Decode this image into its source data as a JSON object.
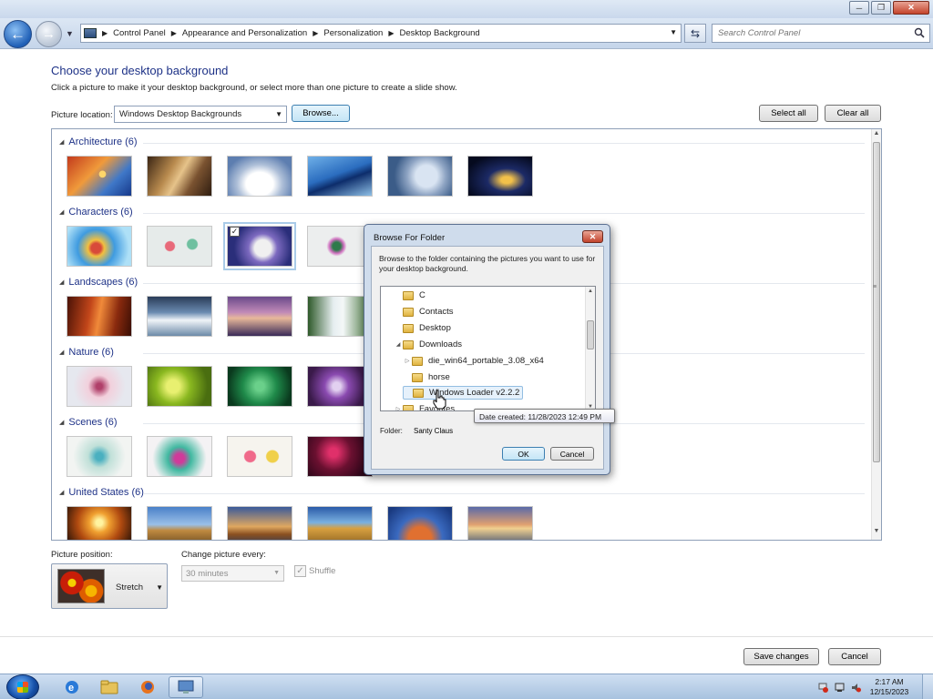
{
  "window": {
    "caption_buttons": {
      "minimize": "minimize-icon",
      "maximize": "restore-icon",
      "close": "close-icon"
    }
  },
  "navbar": {
    "breadcrumbs": [
      "Control Panel",
      "Appearance and Personalization",
      "Personalization",
      "Desktop Background"
    ],
    "search_placeholder": "Search Control Panel"
  },
  "main": {
    "title": "Choose your desktop background",
    "subtitle": "Click a picture to make it your desktop background, or select more than one picture to create a slide show.",
    "picture_location_label": "Picture location:",
    "picture_location_value": "Windows Desktop Backgrounds",
    "browse_label": "Browse...",
    "select_all_label": "Select all",
    "clear_all_label": "Clear all",
    "groups": [
      {
        "label": "Architecture (6)"
      },
      {
        "label": "Characters (6)"
      },
      {
        "label": "Landscapes (6)"
      },
      {
        "label": "Nature (6)"
      },
      {
        "label": "Scenes (6)"
      },
      {
        "label": "United States (6)"
      }
    ],
    "picture_position_label": "Picture position:",
    "picture_position_value": "Stretch",
    "change_every_label": "Change picture every:",
    "change_every_value": "30 minutes",
    "shuffle_label": "Shuffle",
    "save_label": "Save changes",
    "cancel_label": "Cancel"
  },
  "dialog": {
    "title": "Browse For Folder",
    "message": "Browse to the folder containing the pictures you want to use for your desktop background.",
    "tree": [
      {
        "label": "C"
      },
      {
        "label": "Contacts"
      },
      {
        "label": "Desktop"
      },
      {
        "label": "Downloads"
      },
      {
        "label": "die_win64_portable_3.08_x64"
      },
      {
        "label": "horse"
      },
      {
        "label": "Windows Loader v2.2.2"
      },
      {
        "label": "Favorites"
      }
    ],
    "folder_label": "Folder:",
    "folder_value": "Santy Claus",
    "ok_label": "OK",
    "cancel_label": "Cancel",
    "tooltip": "Date created: 11/28/2023 12:49 PM"
  },
  "taskbar": {
    "time": "2:17 AM",
    "date": "12/15/2023"
  },
  "colors": {
    "accent_title": "#1e3287",
    "selection": "#e6f1fb",
    "taskbar": "#a8c2df"
  }
}
